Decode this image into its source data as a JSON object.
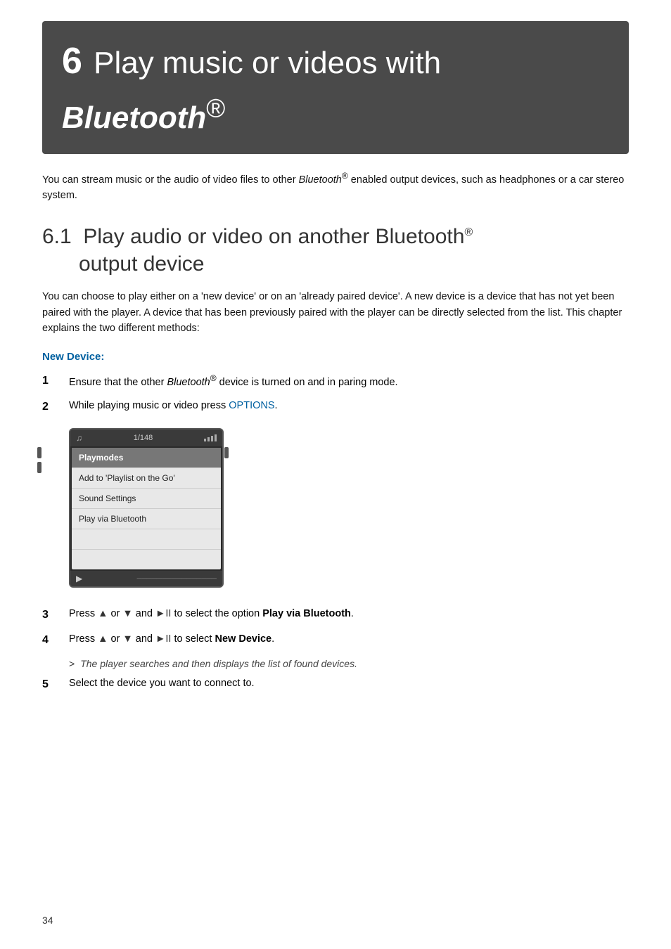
{
  "chapter": {
    "number": "6",
    "title_plain": "Play music or videos with ",
    "title_italic": "Bluetooth",
    "title_sup": "®"
  },
  "intro": {
    "text": "You can stream music or the audio of video files to other ",
    "bt_italic": "Bluetooth",
    "bt_sup": "®",
    "text2": " enabled output devices, such as headphones or a car stereo system."
  },
  "section": {
    "number": "6.1",
    "title": "Play audio or video on another Bluetooth",
    "sup": "®",
    "title2": "output device"
  },
  "body_text": "You can choose to play either on a 'new device' or on an 'already paired device'. A new device is a device that has not yet been paired with the player. A device that has been previously paired with the player can be directly selected from the list. This chapter explains the two different methods:",
  "sub_heading": "New Device:",
  "steps": [
    {
      "num": "1",
      "text_before": "Ensure that the other ",
      "bt_italic": "Bluetooth",
      "bt_sup": "®",
      "text_after": " device is turned on and in paring mode."
    },
    {
      "num": "2",
      "text_before": "While playing music or video press ",
      "options_text": "OPTIONS",
      "text_after": "."
    },
    {
      "num": "3",
      "text_before": "Press ",
      "symbol1": "▲",
      "text_mid1": " or ",
      "symbol2": "▼",
      "text_mid2": " and ",
      "symbol3": "►II",
      "text_after": " to select the option ",
      "bold_text": "Play via Bluetooth",
      "text_end": "."
    },
    {
      "num": "4",
      "text_before": "Press ",
      "symbol1": "▲",
      "text_mid1": " or ",
      "symbol2": "▼",
      "text_mid2": " and ",
      "symbol3": "►II",
      "text_after": " to select ",
      "bold_text": "New Device",
      "text_end": "."
    }
  ],
  "sub_result": "The player searches and then displays the list of found devices.",
  "step5": {
    "num": "5",
    "text": "Select the device you want to connect to."
  },
  "device_mockup": {
    "top_track": "1/148",
    "menu_items": [
      {
        "label": "Playmodes",
        "type": "header"
      },
      {
        "label": "Add to 'Playlist on the Go'",
        "type": "normal"
      },
      {
        "label": "Sound Settings",
        "type": "normal"
      },
      {
        "label": "Play via Bluetooth",
        "type": "normal"
      }
    ]
  },
  "page_number": "34"
}
